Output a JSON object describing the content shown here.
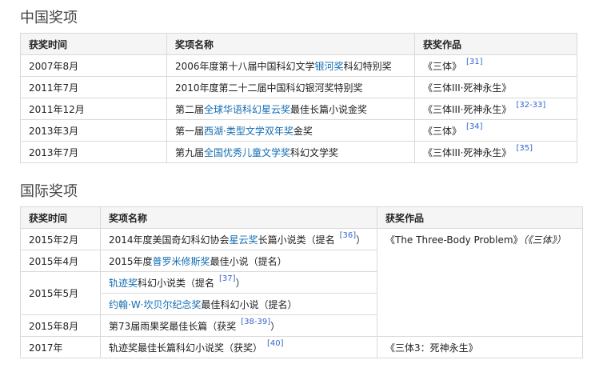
{
  "domestic": {
    "title": "中国奖项",
    "headers": [
      "获奖时间",
      "奖项名称",
      "获奖作品"
    ],
    "rows": [
      {
        "date": "2007年8月",
        "award": [
          {
            "t": "2006年度第十八届中国科幻文学"
          },
          {
            "t": "银河奖",
            "link": true
          },
          {
            "t": "科幻特别奖"
          }
        ],
        "work": "《三体》",
        "ref": "[31]"
      },
      {
        "date": "2011年7月",
        "award": [
          {
            "t": "2010年度第二十二届中国科幻银河奖特别奖"
          }
        ],
        "work": "《三体III·死神永生》",
        "ref": ""
      },
      {
        "date": "2011年12月",
        "award": [
          {
            "t": "第二届"
          },
          {
            "t": "全球华语科幻星云奖",
            "link": true
          },
          {
            "t": "最佳长篇小说金奖"
          }
        ],
        "work": "《三体III·死神永生》",
        "ref": "[32-33]"
      },
      {
        "date": "2013年3月",
        "award": [
          {
            "t": "第一届"
          },
          {
            "t": "西湖·类型文学双年奖",
            "link": true
          },
          {
            "t": "金奖"
          }
        ],
        "work": "《三体》",
        "ref": "[34]"
      },
      {
        "date": "2013年7月",
        "award": [
          {
            "t": "第九届"
          },
          {
            "t": "全国优秀儿童文学奖",
            "link": true
          },
          {
            "t": "科幻文学奖"
          }
        ],
        "work": "《三体III·死神永生》",
        "ref": "[35]"
      }
    ]
  },
  "international": {
    "title": "国际奖项",
    "headers": [
      "获奖时间",
      "奖项名称",
      "获奖作品"
    ],
    "rows": [
      {
        "date": "2015年2月",
        "award": [
          {
            "t": "2014年度美国奇幻科幻协会"
          },
          {
            "t": "星云奖",
            "link": true
          },
          {
            "t": "长篇小说类（提名"
          }
        ],
        "ref": "[36]",
        "after": "）"
      },
      {
        "date": "2015年4月",
        "award": [
          {
            "t": "2015年度"
          },
          {
            "t": "普罗米修斯奖",
            "link": true
          },
          {
            "t": "最佳小说（提名）"
          }
        ],
        "ref": "",
        "after": ""
      },
      {
        "date": "2015年5月",
        "award": [
          {
            "t": "轨迹奖",
            "link": true
          },
          {
            "t": "科幻小说类（提名"
          }
        ],
        "ref": "[37]",
        "after": "）"
      },
      {
        "date": "",
        "award": [
          {
            "t": "约翰·W·坎贝尔纪念奖",
            "link": true
          },
          {
            "t": "最佳科幻小说（提名）"
          }
        ],
        "ref": "",
        "after": ""
      },
      {
        "date": "2015年8月",
        "award": [
          {
            "t": "第73届雨果奖最佳长篇（获奖"
          }
        ],
        "ref": "[38-39]",
        "after": "）"
      },
      {
        "date": "2017年",
        "award": [
          {
            "t": "轨迹奖最佳长篇科幻小说奖（获奖）"
          }
        ],
        "ref": "[40]",
        "after": ""
      }
    ],
    "work_multi": "《The Three-Body Problem》",
    "work_multi_italic": "（《三体》）",
    "work_last": "《三体3：死神永生》"
  }
}
